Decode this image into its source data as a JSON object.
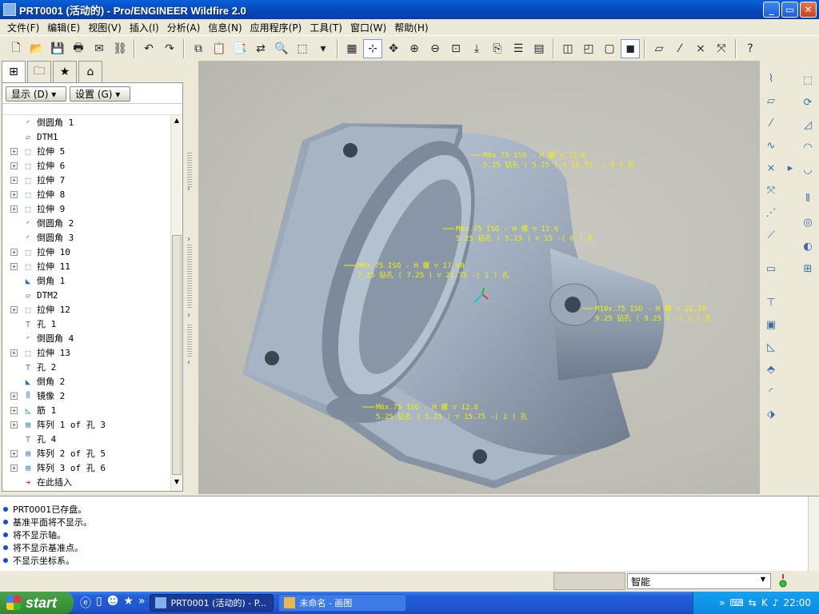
{
  "window": {
    "title": "PRT0001 (活动的) - Pro/ENGINEER Wildfire 2.0",
    "minimize": "_",
    "maximize": "▭",
    "close": "✕"
  },
  "menu": [
    "文件(F)",
    "编辑(E)",
    "视图(V)",
    "插入(I)",
    "分析(A)",
    "信息(N)",
    "应用程序(P)",
    "工具(T)",
    "窗口(W)",
    "帮助(H)"
  ],
  "panel": {
    "show_button": "显示 (D) ▾",
    "settings_button": "设置 (G) ▾"
  },
  "tree": [
    {
      "label": "倒圆角 1",
      "icon": "round-icon",
      "expandable": false
    },
    {
      "label": "DTM1",
      "icon": "datum-plane-icon",
      "expandable": false
    },
    {
      "label": "拉伸 5",
      "icon": "extrude-icon",
      "expandable": true
    },
    {
      "label": "拉伸 6",
      "icon": "extrude-icon",
      "expandable": true
    },
    {
      "label": "拉伸 7",
      "icon": "extrude-icon",
      "expandable": true
    },
    {
      "label": "拉伸 8",
      "icon": "extrude-icon",
      "expandable": true
    },
    {
      "label": "拉伸 9",
      "icon": "extrude-icon",
      "expandable": true
    },
    {
      "label": "倒圆角 2",
      "icon": "round-icon",
      "expandable": false
    },
    {
      "label": "倒圆角 3",
      "icon": "round-icon",
      "expandable": false
    },
    {
      "label": "拉伸 10",
      "icon": "extrude-icon",
      "expandable": true
    },
    {
      "label": "拉伸 11",
      "icon": "extrude-icon",
      "expandable": true
    },
    {
      "label": "倒角 1",
      "icon": "chamfer-icon",
      "expandable": false
    },
    {
      "label": "DTM2",
      "icon": "datum-plane-icon",
      "expandable": false
    },
    {
      "label": "拉伸 12",
      "icon": "extrude-icon",
      "expandable": true
    },
    {
      "label": "孔 1",
      "icon": "hole-icon",
      "expandable": false
    },
    {
      "label": "倒圆角 4",
      "icon": "round-icon",
      "expandable": false
    },
    {
      "label": "拉伸 13",
      "icon": "extrude-icon",
      "expandable": true
    },
    {
      "label": "孔 2",
      "icon": "hole-icon",
      "expandable": false
    },
    {
      "label": "倒角 2",
      "icon": "chamfer-icon",
      "expandable": false
    },
    {
      "label": "镜像 2",
      "icon": "mirror-icon",
      "expandable": true
    },
    {
      "label": "筋 1",
      "icon": "rib-icon",
      "expandable": true
    },
    {
      "label": "阵列 1 of 孔 3",
      "icon": "pattern-icon",
      "expandable": true
    },
    {
      "label": "孔 4",
      "icon": "hole-icon",
      "expandable": false
    },
    {
      "label": "阵列 2 of 孔 5",
      "icon": "pattern-icon",
      "expandable": true
    },
    {
      "label": "阵列 3 of 孔 6",
      "icon": "pattern-icon",
      "expandable": true
    },
    {
      "label": "在此插入",
      "icon": "insert-here-icon",
      "expandable": false
    }
  ],
  "annotations": [
    {
      "line1": "M6x.75 ISO - H 螺 ▽ 12.6",
      "line2": "5.25 钻孔 ( 5.25 ) ▽ 15.75  -( 3 ) 孔"
    },
    {
      "line1": "M6x.75 ISO - H 螺 ▽ 12.6",
      "line2": "5.25 钻孔 ( 5.25 ) ▽ 15  -( 6 ) 孔"
    },
    {
      "line1": "M8x.75 ISO - H 螺 ▽ 17.40",
      "line2": "7.25 钻孔 ( 7.25 ) ▽ 21.75  -( 1 ) 孔"
    },
    {
      "line1": "M10x.75 ISO - H 螺 ▽ 22.20",
      "line2": "9.25 钻孔 ( 9.25 )  -( 1 ) 孔"
    },
    {
      "line1": "M6x.75 ISO - H 螺 ▽ 12.6",
      "line2": "5.25 钻孔 ( 5.25 ) ▽ 15.75  -( 1 ) 孔"
    }
  ],
  "messages": [
    "PRT0001已存盘。",
    "基准平面将不显示。",
    "将不显示轴。",
    "将不显示基准点。",
    "不显示坐标系。"
  ],
  "status": {
    "filter": "智能"
  },
  "taskbar": {
    "start": "start",
    "tasks": [
      "PRT0001 (活动的) - P...",
      "未命名 - 画图"
    ],
    "clock": "22:00"
  },
  "colors": {
    "annotation": "#f2f200",
    "model": "#9aa8b8",
    "tree_icon": "#2a7ab0"
  }
}
